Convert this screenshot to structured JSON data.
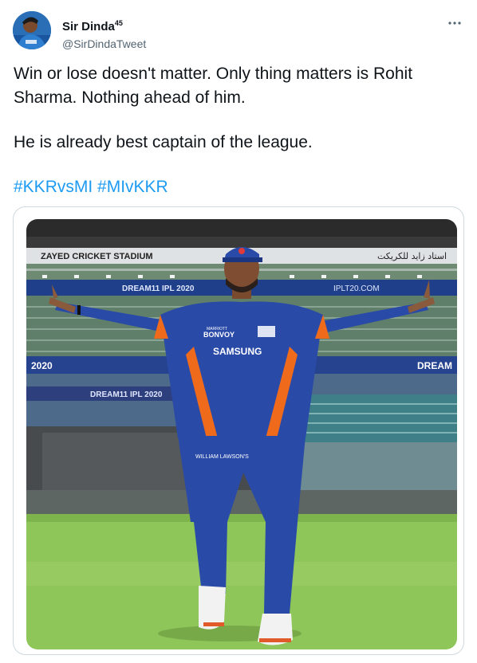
{
  "author": {
    "display_name": "Sir Dinda",
    "superscript": "45",
    "handle": "@SirDindaTweet",
    "avatar_icon": "profile-photo"
  },
  "more_menu_icon": "ellipsis-icon",
  "tweet": {
    "line1": "Win or lose doesn't matter. Only thing matters is Rohit Sharma. Nothing ahead of him.",
    "line2": "He is already best captain of the league.",
    "hashtags": [
      "#KKRvsMI",
      "#MIvKKR"
    ]
  },
  "photo": {
    "stadium_sign": "ZAYED CRICKET STADIUM",
    "arabic_sign": "استاد زايد للكريكت",
    "banner_top": "DREAM11 IPL 2020",
    "banner_url": "IPLT20.COM",
    "banner_mid_left": "2020",
    "banner_mid_right": "DREAM",
    "banner_low": "DREAM11 IPL 2020",
    "jersey_sponsor": "SAMSUNG",
    "jersey_brand": "BONVOY",
    "jersey_brand_top": "MARRIOTT",
    "shorts_brand": "WILLIAM LAWSON'S"
  },
  "colors": {
    "link": "#1d9bf0",
    "jersey_blue": "#2a4aa8",
    "jersey_orange": "#f06a1c",
    "grass": "#8fc65a"
  }
}
